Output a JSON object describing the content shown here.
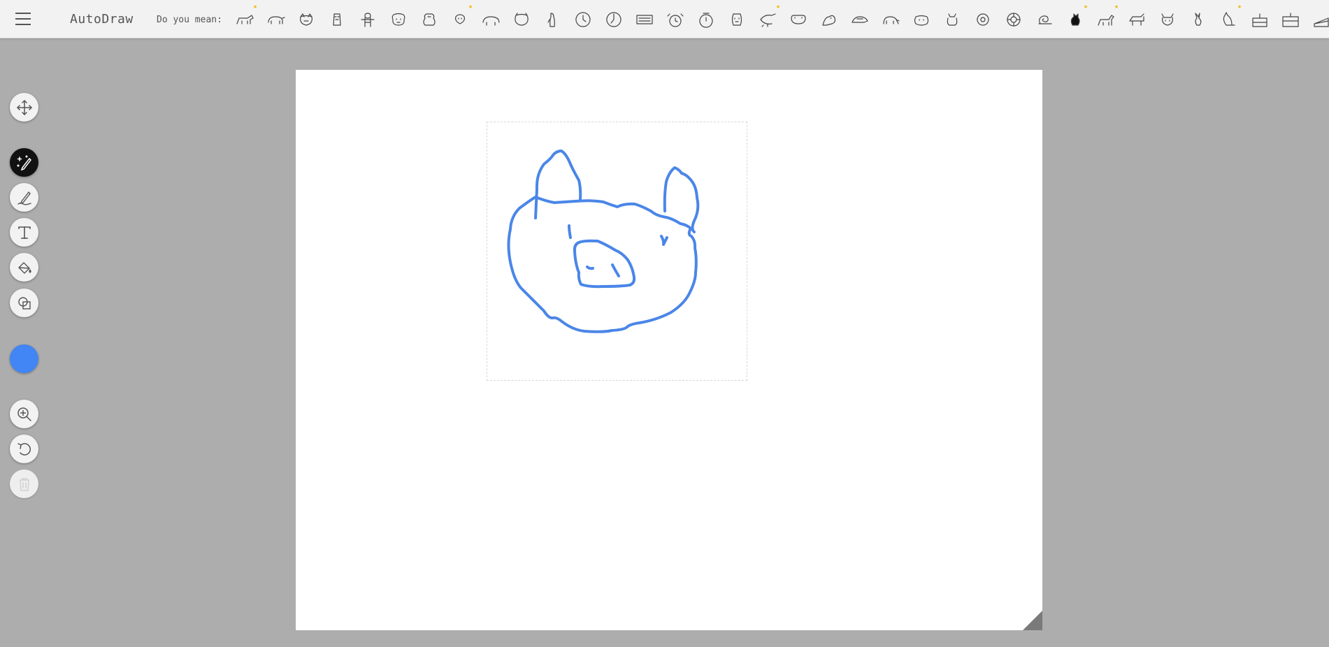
{
  "app": {
    "title": "AutoDraw"
  },
  "header": {
    "menu_icon": "hamburger-menu-icon",
    "do_you_mean_label": "Do you mean:",
    "suggestions": [
      {
        "icon": "dog-outline-icon",
        "starred": true
      },
      {
        "icon": "pig-icon",
        "starred": false
      },
      {
        "icon": "pig-face-icon",
        "starred": false
      },
      {
        "icon": "owl-icon",
        "starred": false
      },
      {
        "icon": "gingerbread-man-icon",
        "starred": false
      },
      {
        "icon": "dog-face-icon",
        "starred": false
      },
      {
        "icon": "teddy-bear-icon",
        "starred": false
      },
      {
        "icon": "bear-face-icon",
        "starred": true
      },
      {
        "icon": "polar-bear-icon",
        "starred": false
      },
      {
        "icon": "bear-head-icon",
        "starred": false
      },
      {
        "icon": "penguin-icon",
        "starred": false
      },
      {
        "icon": "clock-icon",
        "starred": false
      },
      {
        "icon": "wall-clock-icon",
        "starred": false
      },
      {
        "icon": "digital-clock-icon",
        "starred": false
      },
      {
        "icon": "alarm-clock-icon",
        "starred": false
      },
      {
        "icon": "alarm-clock-2-icon",
        "starred": false
      },
      {
        "icon": "face-icon",
        "starred": false
      },
      {
        "icon": "frog-icon",
        "starred": true
      },
      {
        "icon": "frog-face-icon",
        "starred": false
      },
      {
        "icon": "sitting-frog-icon",
        "starred": false
      },
      {
        "icon": "turtle-icon",
        "starred": false
      },
      {
        "icon": "elephant-icon",
        "starred": false
      },
      {
        "icon": "hamster-icon",
        "starred": false
      },
      {
        "icon": "cat-sitting-icon",
        "starred": false
      },
      {
        "icon": "donut-icon",
        "starred": false
      },
      {
        "icon": "wheel-icon",
        "starred": false
      },
      {
        "icon": "snail-icon",
        "starred": false
      },
      {
        "icon": "black-cat-icon",
        "starred": true
      },
      {
        "icon": "walking-cat-icon",
        "starred": true
      },
      {
        "icon": "cat-icon",
        "starred": false
      },
      {
        "icon": "cat-face-icon",
        "starred": false
      },
      {
        "icon": "rabbit-icon",
        "starred": false
      },
      {
        "icon": "kangaroo-icon",
        "starred": true
      },
      {
        "icon": "birthday-cake-icon",
        "starred": false
      },
      {
        "icon": "layer-cake-icon",
        "starred": false
      },
      {
        "icon": "cake-slice-icon",
        "starred": false
      }
    ]
  },
  "toolbar": {
    "tools": [
      {
        "name": "select-tool",
        "icon": "move-arrows-icon",
        "active": false,
        "disabled": false
      },
      {
        "name": "autodraw-tool",
        "icon": "autodraw-pen-sparkle-icon",
        "active": true,
        "disabled": false
      },
      {
        "name": "draw-tool",
        "icon": "pencil-icon",
        "active": false,
        "disabled": false
      },
      {
        "name": "type-tool",
        "icon": "text-t-icon",
        "active": false,
        "disabled": false
      },
      {
        "name": "fill-tool",
        "icon": "paint-bucket-icon",
        "active": false,
        "disabled": false
      },
      {
        "name": "shape-tool",
        "icon": "shapes-icon",
        "active": false,
        "disabled": false
      },
      {
        "name": "zoom-tool",
        "icon": "zoom-in-icon",
        "active": false,
        "disabled": false
      },
      {
        "name": "undo-tool",
        "icon": "undo-icon",
        "active": false,
        "disabled": false
      },
      {
        "name": "delete-tool",
        "icon": "trash-icon",
        "active": false,
        "disabled": true
      }
    ],
    "current_color": "#4285f4"
  },
  "colors": {
    "background": "#adadad",
    "stroke": "#4a86e8",
    "star": "#f4b400"
  }
}
